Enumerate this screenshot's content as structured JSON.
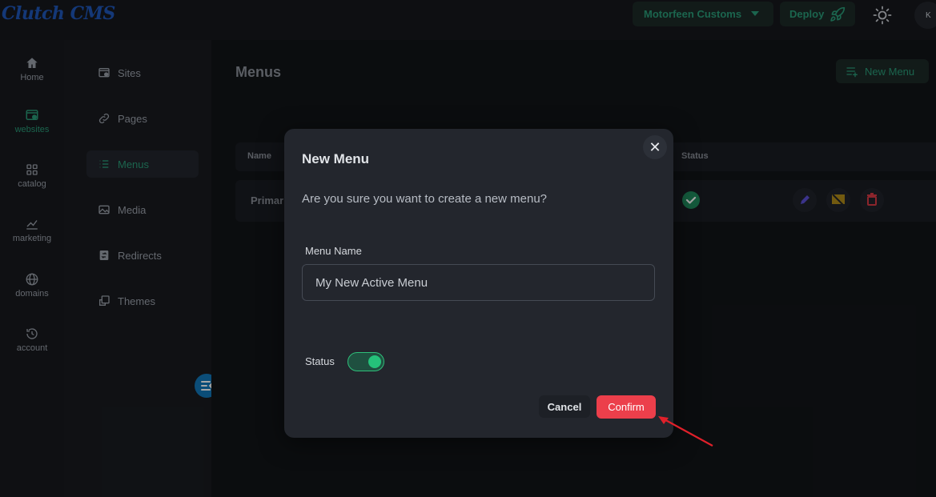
{
  "app": {
    "logo": "Clutch CMS"
  },
  "topbar": {
    "site_selector": "Motorfeen Customs",
    "deploy_label": "Deploy",
    "avatar_initial": "K"
  },
  "rail": {
    "items": [
      {
        "label": "Home",
        "icon": "home-icon"
      },
      {
        "label": "websites",
        "icon": "website-icon",
        "active": true
      },
      {
        "label": "catalog",
        "icon": "grid-icon"
      },
      {
        "label": "marketing",
        "icon": "chart-icon"
      },
      {
        "label": "domains",
        "icon": "globe-icon"
      },
      {
        "label": "account",
        "icon": "history-icon"
      }
    ]
  },
  "subnav": {
    "items": [
      {
        "label": "Sites",
        "icon": "browser-icon"
      },
      {
        "label": "Pages",
        "icon": "link-icon"
      },
      {
        "label": "Menus",
        "icon": "list-icon",
        "active": true
      },
      {
        "label": "Media",
        "icon": "image-icon"
      },
      {
        "label": "Redirects",
        "icon": "redirect-icon"
      },
      {
        "label": "Themes",
        "icon": "theme-icon"
      }
    ]
  },
  "main": {
    "title": "Menus",
    "new_button": "New Menu",
    "table": {
      "headers": [
        "Name",
        "Status"
      ],
      "rows": [
        {
          "name": "Primar",
          "status": "active"
        }
      ]
    }
  },
  "modal": {
    "title": "New Menu",
    "question": "Are you sure you want to create a new menu?",
    "field_label": "Menu Name",
    "field_value": "My New Active Menu",
    "status_label": "Status",
    "status_on": true,
    "cancel_label": "Cancel",
    "confirm_label": "Confirm",
    "close_glyph": "✕"
  },
  "colors": {
    "accent": "#2a9b78",
    "danger": "#ec3f4b",
    "brand": "#1f56b8"
  }
}
